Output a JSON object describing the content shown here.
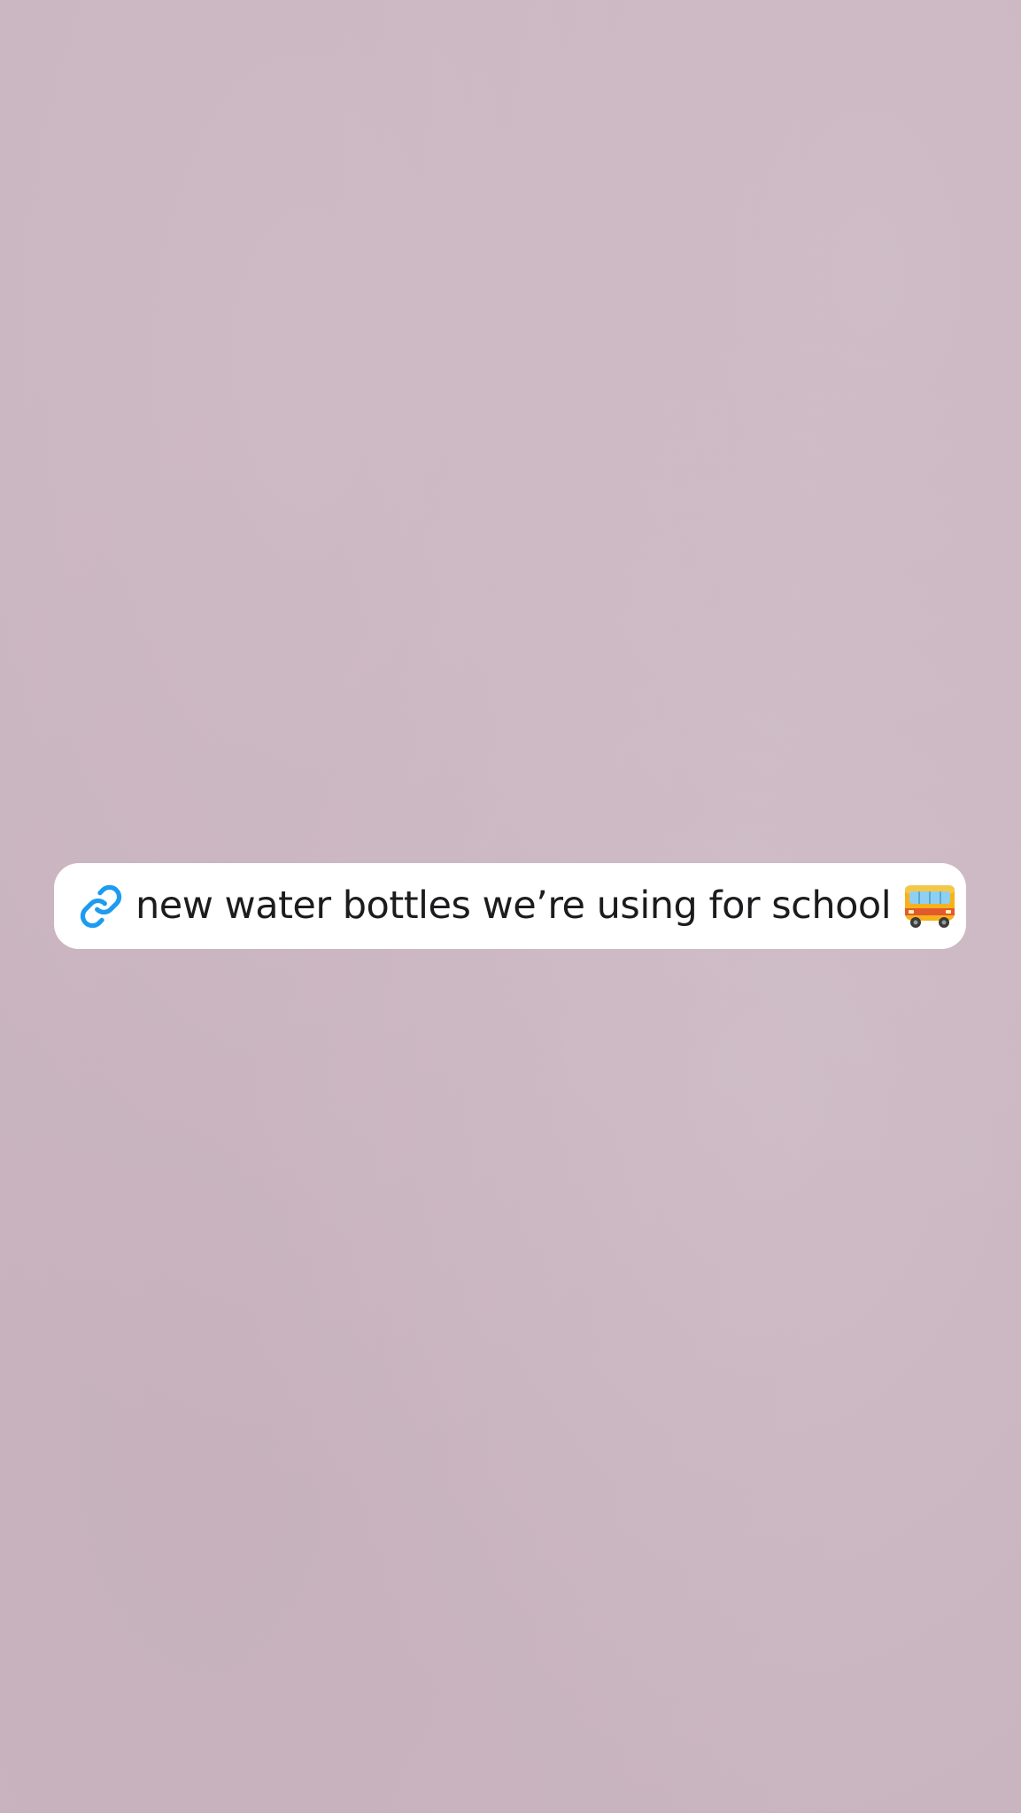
{
  "story": {
    "background_color": "#c9b5bf",
    "link_sticker": {
      "text": "new water bottles we’re using for school",
      "link_icon": "link-chain-icon",
      "trailing_emoji": "bus-icon",
      "icon_color": "#1d9bf0"
    }
  }
}
